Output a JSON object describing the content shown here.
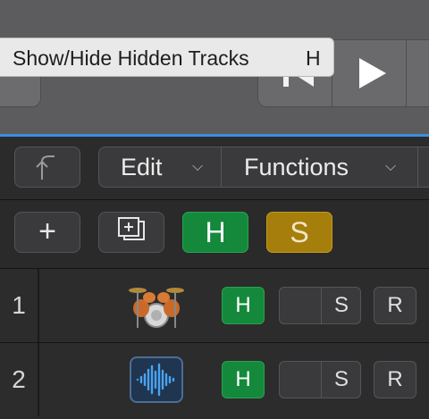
{
  "tooltip": {
    "text": "Show/Hide Hidden Tracks",
    "shortcut": "H"
  },
  "toolbar": {
    "edit_label": "Edit",
    "functions_label": "Functions",
    "chevron": "⌵"
  },
  "global_buttons": {
    "add_label": "+",
    "hide_label": "H",
    "solo_label": "S"
  },
  "tracks": [
    {
      "number": "1",
      "icon": "drum-kit-icon",
      "hide_label": "H",
      "solo_label": "S",
      "record_label": "R"
    },
    {
      "number": "2",
      "icon": "audio-waveform-icon",
      "hide_label": "H",
      "solo_label": "S",
      "record_label": "R"
    }
  ],
  "colors": {
    "hide_active": "#14893b",
    "solo_active": "#a57e0b",
    "selection_line": "#3b8fe0"
  }
}
